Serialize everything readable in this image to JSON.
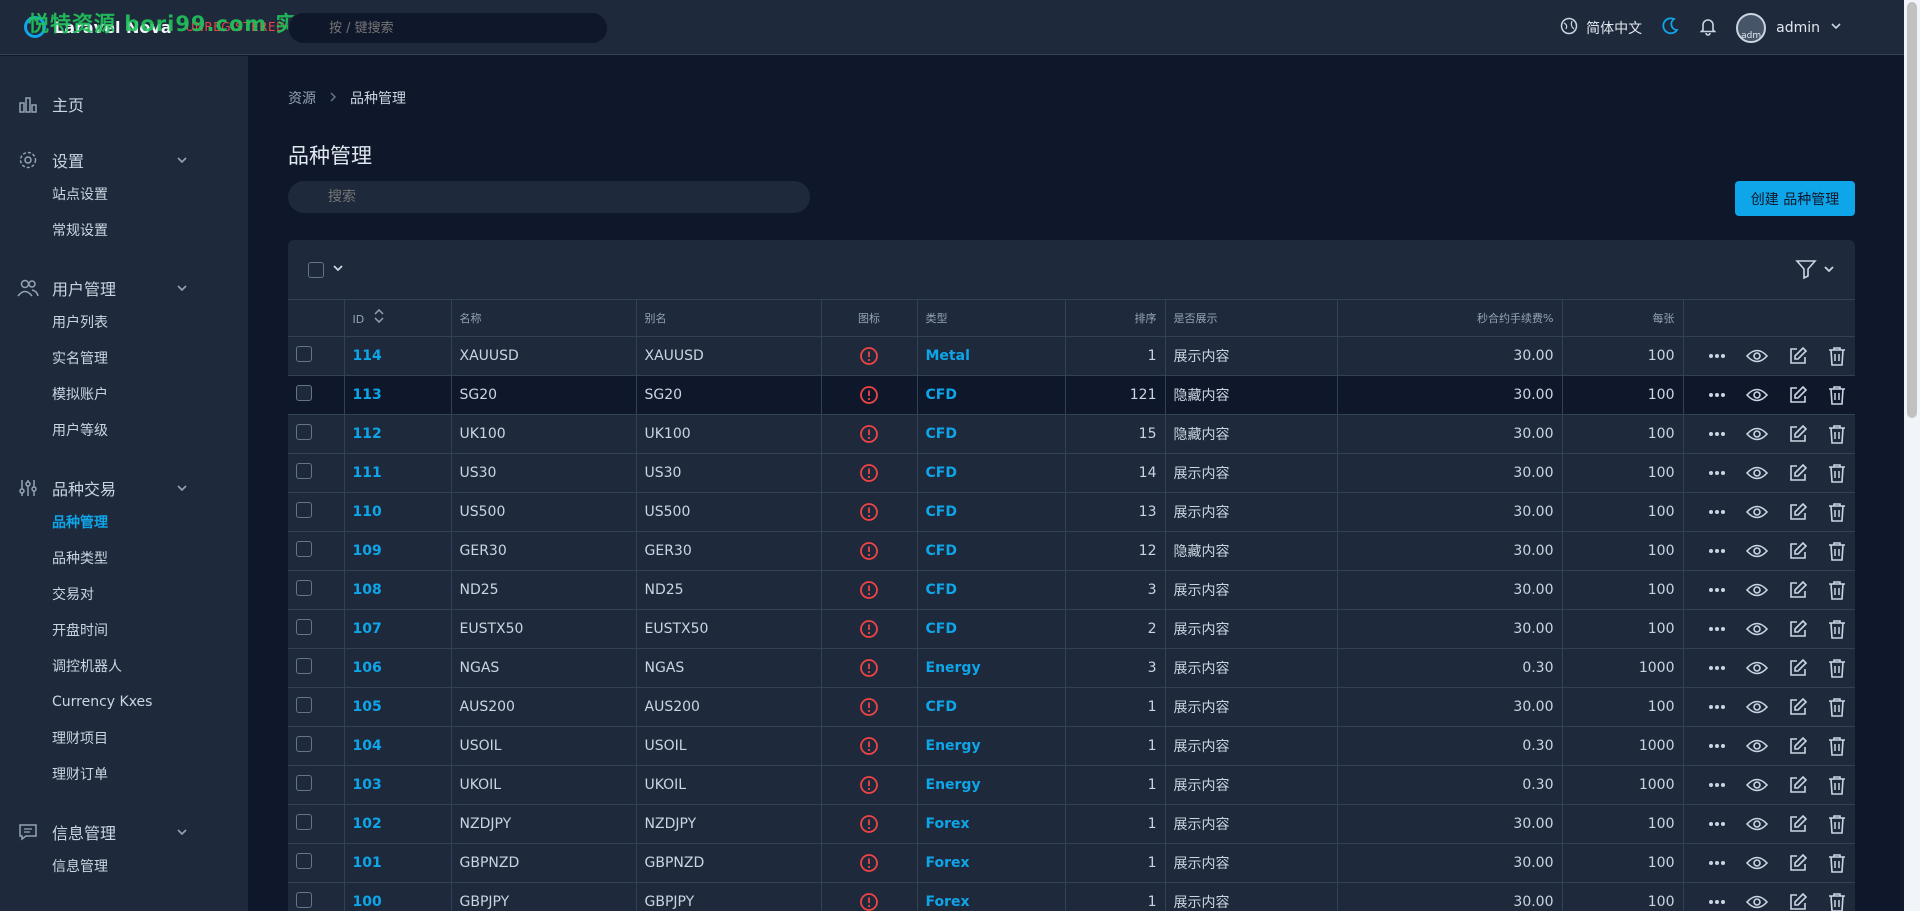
{
  "app": {
    "name": "Laravel Nova",
    "unregistered": "UNREGISTERED",
    "watermark": "悦特资源 bori99.com 实测分享",
    "global_search_placeholder": "按 / 键搜索",
    "language": "简体中文",
    "user": "admin",
    "avatar_alt": "adm"
  },
  "sidebar": {
    "home": "主页",
    "settings": {
      "label": "设置",
      "items": [
        "站点设置",
        "常规设置"
      ]
    },
    "users": {
      "label": "用户管理",
      "items": [
        "用户列表",
        "实名管理",
        "模拟账户",
        "用户等级"
      ]
    },
    "trading": {
      "label": "品种交易",
      "items": [
        "品种管理",
        "品种类型",
        "交易对",
        "开盘时间",
        "调控机器人",
        "Currency Kxes",
        "理财项目",
        "理财订单"
      ]
    },
    "info": {
      "label": "信息管理",
      "items": [
        "信息管理"
      ]
    }
  },
  "breadcrumb": [
    "资源",
    "品种管理"
  ],
  "page_title": "品种管理",
  "resource_search_placeholder": "搜索",
  "create_button": "创建 品种管理",
  "table": {
    "headers": {
      "id": "ID",
      "name": "名称",
      "alias": "别名",
      "icon": "图标",
      "type": "类型",
      "sort": "排序",
      "show": "是否展示",
      "fee": "秒合约手续费%",
      "per": "每张"
    },
    "rows": [
      {
        "id": "114",
        "name": "XAUUSD",
        "alias": "XAUUSD",
        "type": "Metal",
        "sort": "1",
        "show": "展示内容",
        "fee": "30.00",
        "per": "100"
      },
      {
        "id": "113",
        "name": "SG20",
        "alias": "SG20",
        "type": "CFD",
        "sort": "121",
        "show": "隐藏内容",
        "fee": "30.00",
        "per": "100"
      },
      {
        "id": "112",
        "name": "UK100",
        "alias": "UK100",
        "type": "CFD",
        "sort": "15",
        "show": "隐藏内容",
        "fee": "30.00",
        "per": "100"
      },
      {
        "id": "111",
        "name": "US30",
        "alias": "US30",
        "type": "CFD",
        "sort": "14",
        "show": "展示内容",
        "fee": "30.00",
        "per": "100"
      },
      {
        "id": "110",
        "name": "US500",
        "alias": "US500",
        "type": "CFD",
        "sort": "13",
        "show": "展示内容",
        "fee": "30.00",
        "per": "100"
      },
      {
        "id": "109",
        "name": "GER30",
        "alias": "GER30",
        "type": "CFD",
        "sort": "12",
        "show": "隐藏内容",
        "fee": "30.00",
        "per": "100"
      },
      {
        "id": "108",
        "name": "ND25",
        "alias": "ND25",
        "type": "CFD",
        "sort": "3",
        "show": "展示内容",
        "fee": "30.00",
        "per": "100"
      },
      {
        "id": "107",
        "name": "EUSTX50",
        "alias": "EUSTX50",
        "type": "CFD",
        "sort": "2",
        "show": "展示内容",
        "fee": "30.00",
        "per": "100"
      },
      {
        "id": "106",
        "name": "NGAS",
        "alias": "NGAS",
        "type": "Energy",
        "sort": "3",
        "show": "展示内容",
        "fee": "0.30",
        "per": "1000"
      },
      {
        "id": "105",
        "name": "AUS200",
        "alias": "AUS200",
        "type": "CFD",
        "sort": "1",
        "show": "展示内容",
        "fee": "30.00",
        "per": "100"
      },
      {
        "id": "104",
        "name": "USOIL",
        "alias": "USOIL",
        "type": "Energy",
        "sort": "1",
        "show": "展示内容",
        "fee": "0.30",
        "per": "1000"
      },
      {
        "id": "103",
        "name": "UKOIL",
        "alias": "UKOIL",
        "type": "Energy",
        "sort": "1",
        "show": "展示内容",
        "fee": "0.30",
        "per": "1000"
      },
      {
        "id": "102",
        "name": "NZDJPY",
        "alias": "NZDJPY",
        "type": "Forex",
        "sort": "1",
        "show": "展示内容",
        "fee": "30.00",
        "per": "100"
      },
      {
        "id": "101",
        "name": "GBPNZD",
        "alias": "GBPNZD",
        "type": "Forex",
        "sort": "1",
        "show": "展示内容",
        "fee": "30.00",
        "per": "100"
      },
      {
        "id": "100",
        "name": "GBPJPY",
        "alias": "GBPJPY",
        "type": "Forex",
        "sort": "1",
        "show": "展示内容",
        "fee": "30.00",
        "per": "100"
      }
    ]
  },
  "colors": {
    "accent": "#0ea5e9",
    "danger": "#ef4444",
    "bg": "#0f172a",
    "panel": "#1e293b"
  }
}
